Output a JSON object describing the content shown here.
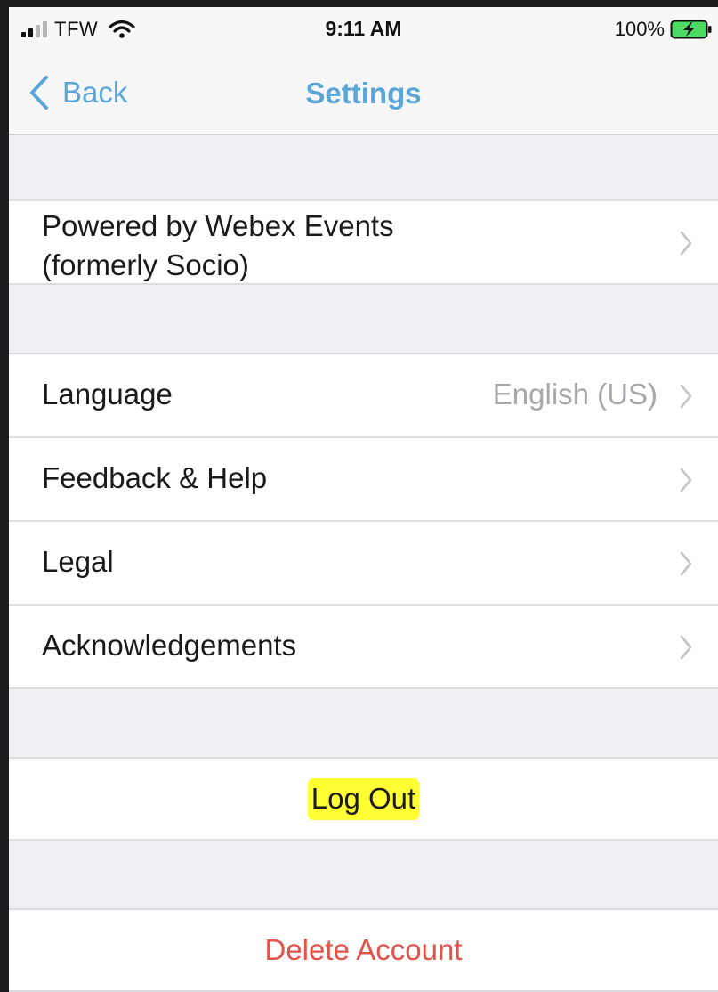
{
  "status_bar": {
    "carrier": "TFW",
    "time": "9:11 AM",
    "battery_percent": "100%",
    "signal_bars": 4,
    "signal_active_bars": 2,
    "battery_charging": true
  },
  "nav": {
    "back_label": "Back",
    "title": "Settings",
    "tint_color": "#5aa6d8"
  },
  "sections": [
    {
      "items": [
        {
          "label": "Powered by Webex Events\n(formerly Socio)",
          "value": "",
          "chevron": true
        }
      ]
    },
    {
      "items": [
        {
          "label": "Language",
          "value": "English (US)",
          "chevron": true
        },
        {
          "label": "Feedback & Help",
          "value": "",
          "chevron": true
        },
        {
          "label": "Legal",
          "value": "",
          "chevron": true
        },
        {
          "label": "Acknowledgements",
          "value": "",
          "chevron": true
        }
      ]
    }
  ],
  "actions": {
    "logout_label": "Log Out",
    "logout_highlight_color": "#ffff33",
    "delete_label": "Delete Account",
    "delete_color": "#e0544b"
  },
  "icons": {
    "back": "chevron-left-icon",
    "disclosure": "chevron-right-icon",
    "wifi": "wifi-icon",
    "battery": "battery-charging-icon",
    "signal": "signal-bars-icon"
  }
}
